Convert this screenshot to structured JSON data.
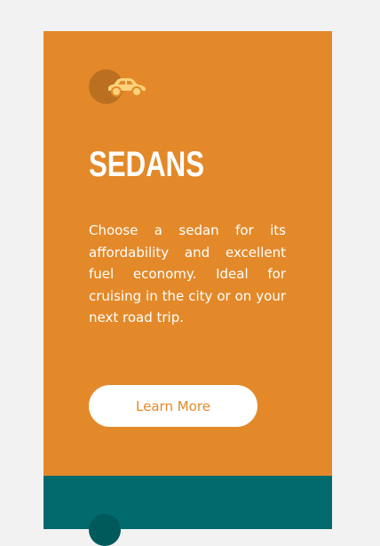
{
  "card": {
    "icon": "car-icon",
    "title": "SEDANS",
    "description": "Choose a sedan for its affordability and excellent fuel economy. Ideal for cruising in the city or on your next road trip.",
    "button_label": "Learn More"
  },
  "colors": {
    "card_bg": "#e3892a",
    "next_card_bg": "#006a6c",
    "icon": "#fcd27a"
  }
}
